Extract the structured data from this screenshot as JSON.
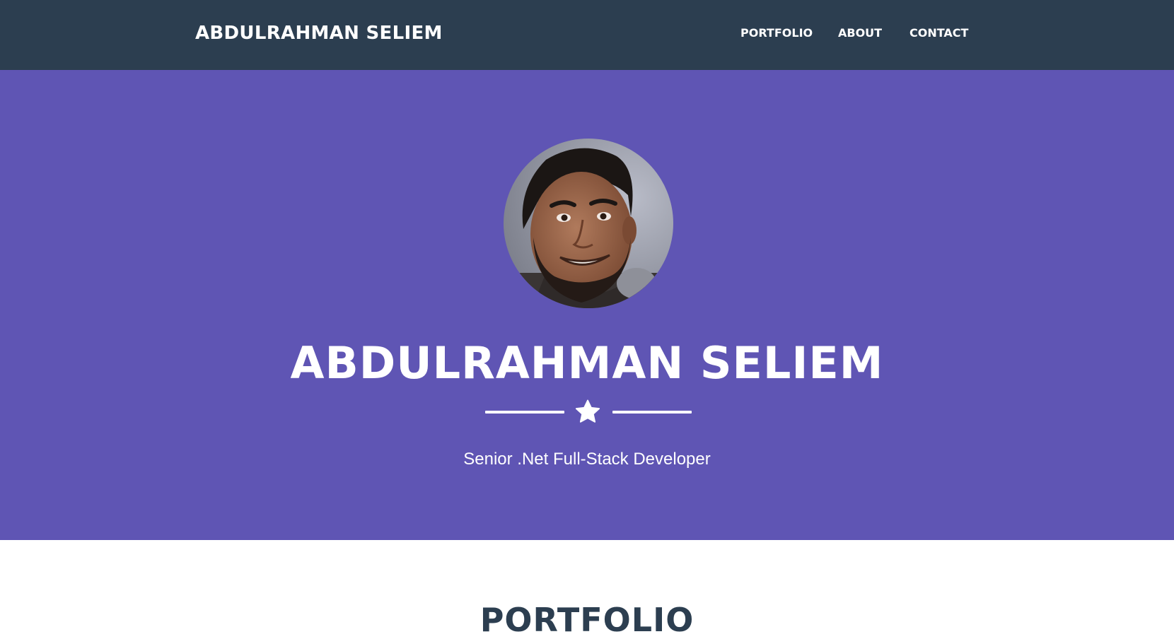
{
  "navbar": {
    "brand": "ABDULRAHMAN SELIEM",
    "links": [
      {
        "label": "PORTFOLIO"
      },
      {
        "label": "ABOUT"
      },
      {
        "label": "CONTACT"
      }
    ],
    "background": "#2c3e50"
  },
  "masthead": {
    "title": "ABDULRAHMAN SELIEM",
    "subtitle": "Senior .Net Full-Stack Developer",
    "divider_icon": "star-icon",
    "background": "#5f55b4"
  },
  "portfolio": {
    "heading": "PORTFOLIO"
  },
  "colors": {
    "primary_dark": "#2c3e50",
    "accent": "#5f55b4",
    "text_light": "#ffffff"
  }
}
